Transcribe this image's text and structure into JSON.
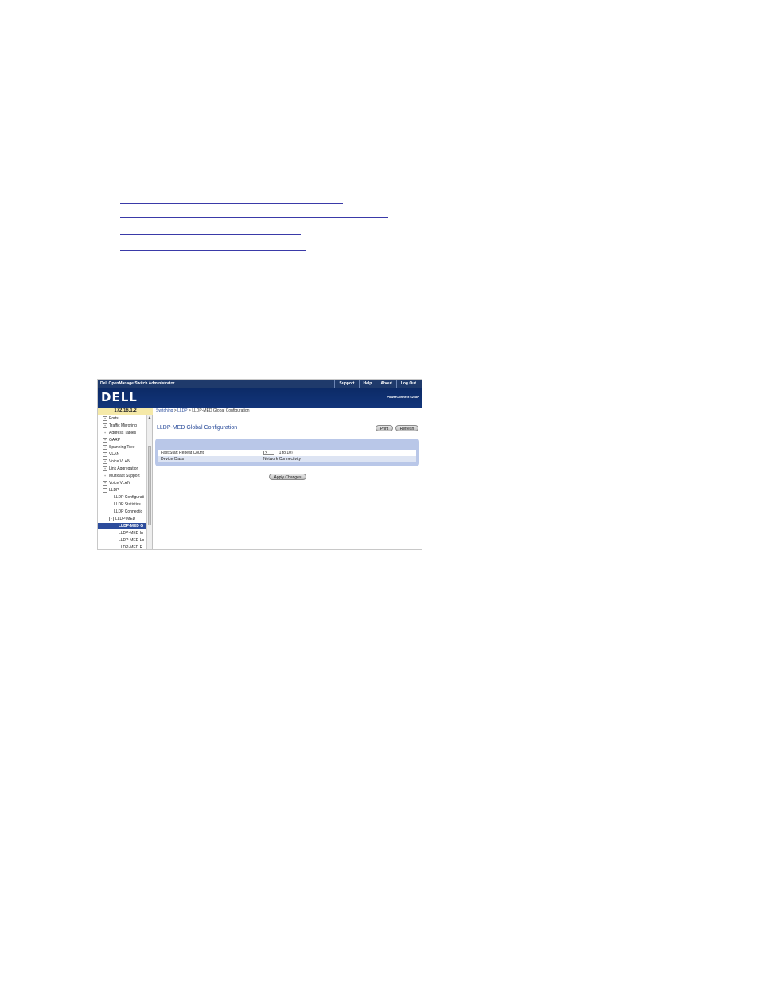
{
  "window": {
    "app_title": "Dell OpenManage Switch Administrator",
    "top_links": [
      "Support",
      "Help",
      "About",
      "Log Out"
    ],
    "logo": "DELL",
    "product": "PowerConnect 6248P"
  },
  "ip_address": "172.16.1.2",
  "breadcrumb": {
    "part1": "Switching",
    "sep": " > ",
    "part2": "LLDP",
    "part3": "LLDP-MED Global Configuration"
  },
  "sidebar": {
    "items": [
      {
        "label": "Ports",
        "expander": "+"
      },
      {
        "label": "Traffic Mirroring",
        "expander": "+"
      },
      {
        "label": "Address Tables",
        "expander": "+"
      },
      {
        "label": "GARP",
        "expander": "+"
      },
      {
        "label": "Spanning Tree",
        "expander": "+"
      },
      {
        "label": "VLAN",
        "expander": "+"
      },
      {
        "label": "Voice VLAN",
        "expander": "+"
      },
      {
        "label": "Link Aggregation",
        "expander": "+"
      },
      {
        "label": "Multicast Support",
        "expander": "+"
      },
      {
        "label": "Voice VLAN",
        "expander": "+"
      },
      {
        "label": "LLDP",
        "expander": "−"
      },
      {
        "label": "LLDP Configurati",
        "expander": ""
      },
      {
        "label": "LLDP Statistics",
        "expander": ""
      },
      {
        "label": "LLDP Connectio",
        "expander": ""
      },
      {
        "label": "LLDP-MED",
        "expander": "−"
      },
      {
        "label": "LLDP-MED G",
        "expander": ""
      },
      {
        "label": "LLDP-MED In",
        "expander": ""
      },
      {
        "label": "LLDP-MED Lo",
        "expander": ""
      },
      {
        "label": "LLDP-MED R",
        "expander": ""
      }
    ],
    "scroll_up_glyph": "▲"
  },
  "main": {
    "title": "LLDP-MED Global Configuration",
    "print_label": "Print",
    "refresh_label": "Refresh",
    "fields": {
      "fast_start_label": "Fast Start Repeat Count",
      "fast_start_value": "3",
      "fast_start_range": "(1 to 10)",
      "device_class_label": "Device Class",
      "device_class_value": "Network Connectivity"
    },
    "apply_label": "Apply Changes"
  }
}
